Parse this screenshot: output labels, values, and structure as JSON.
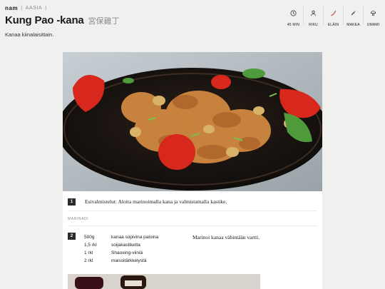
{
  "brand": {
    "logo": "nam",
    "separator": "|",
    "category": "AASIA",
    "separator_end": "|"
  },
  "recipe": {
    "title": "Kung Pao -kana",
    "title_native": "宮保雞丁",
    "subtitle": "Kanaa kiinalaisittain."
  },
  "tags": [
    {
      "icon": "clock-icon",
      "label": "45 MIN"
    },
    {
      "icon": "person-icon",
      "label": "RIKU"
    },
    {
      "icon": "chili-icon",
      "label": "ELÄIN"
    },
    {
      "icon": "sweet-icon",
      "label": "MAKEA"
    },
    {
      "icon": "mushroom-icon",
      "label": "UMAMI"
    }
  ],
  "steps": [
    {
      "num": "1",
      "text": "Esivalmistelut: Aloita marinoimalla kana ja valmistamalla kastike."
    },
    {
      "num": "2",
      "text": "Marinoi kanaa vähintään vartti."
    }
  ],
  "section": {
    "label": "MARINADI"
  },
  "ingredients": [
    {
      "amount": "500g",
      "name": "kanaa sopivina paloina"
    },
    {
      "amount": "1,5 rkl",
      "name": "soijakastiketta"
    },
    {
      "amount": "1 rkl",
      "name": "Shaoxing-viiniä"
    },
    {
      "amount": "2 rkl",
      "name": "maissitärkkelystä"
    }
  ],
  "colors": {
    "background": "#f0f0ef",
    "card": "#ffffff",
    "text": "#1b1b1b",
    "muted": "#8a8a8a",
    "badge": "#2b2b2b"
  }
}
